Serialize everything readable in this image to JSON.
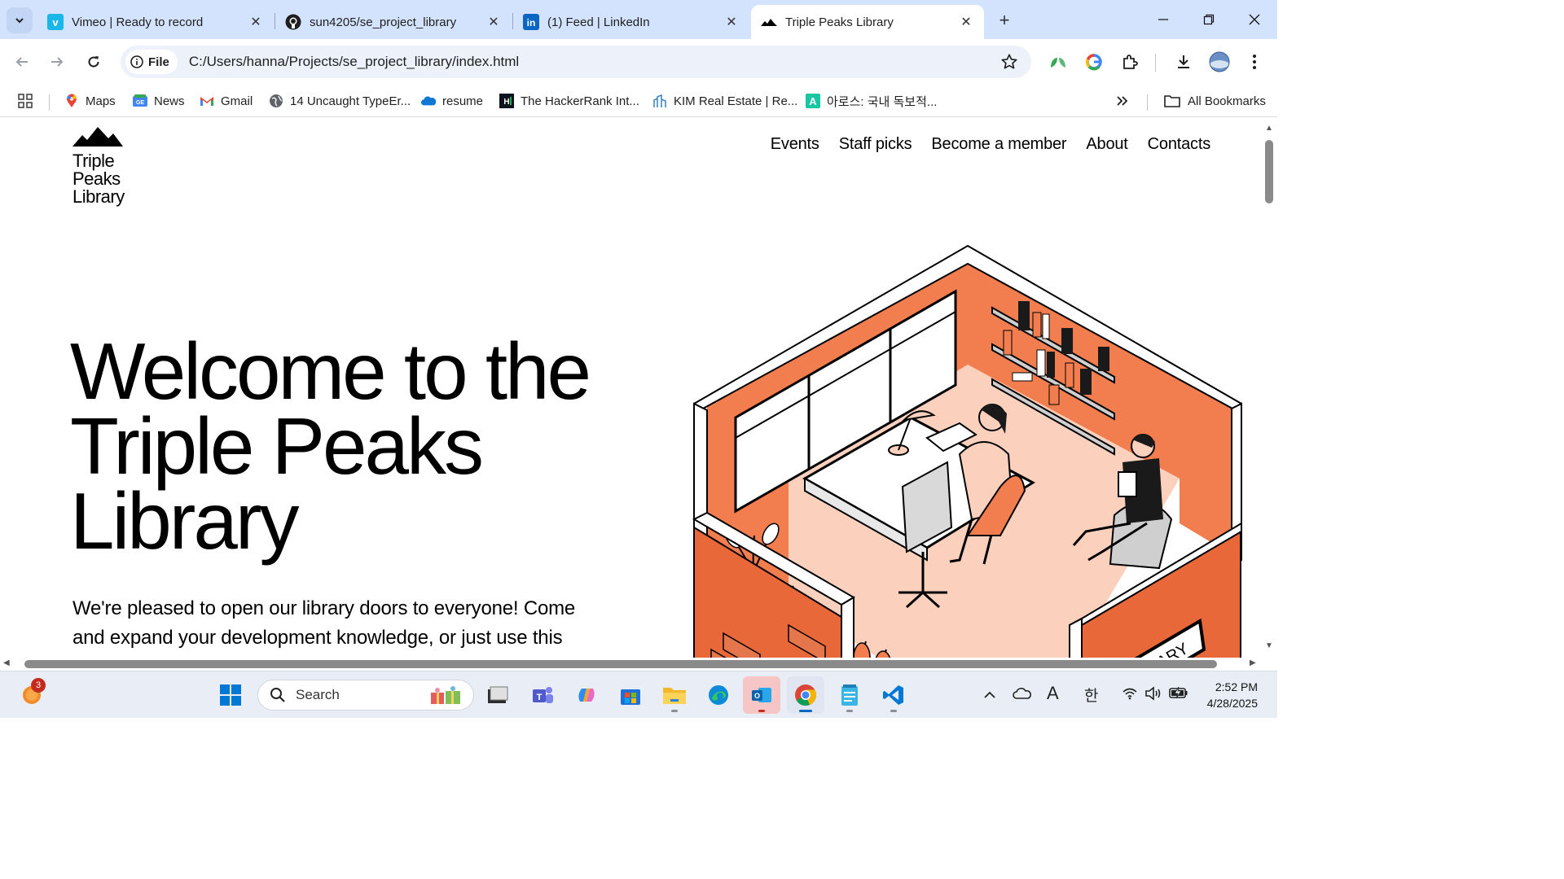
{
  "browser": {
    "tabs": [
      {
        "title": "Vimeo | Ready to record",
        "icon": "vimeo-icon",
        "active": false
      },
      {
        "title": "sun4205/se_project_library",
        "icon": "github-icon",
        "active": false
      },
      {
        "title": "(1) Feed | LinkedIn",
        "icon": "linkedin-icon",
        "active": false
      },
      {
        "title": "Triple Peaks Library",
        "icon": "mountain-icon",
        "active": true
      }
    ],
    "address": {
      "chip_label": "File",
      "url": "C:/Users/hanna/Projects/se_project_library/index.html"
    },
    "bookmarks": [
      {
        "label": "Maps",
        "icon": "maps-icon"
      },
      {
        "label": "News",
        "icon": "news-icon"
      },
      {
        "label": "Gmail",
        "icon": "gmail-icon"
      },
      {
        "label": "14 Uncaught TypeEr...",
        "icon": "globe-icon"
      },
      {
        "label": "resume",
        "icon": "onedrive-icon"
      },
      {
        "label": "The HackerRank Int...",
        "icon": "hackerrank-icon"
      },
      {
        "label": "KIM Real Estate | Re...",
        "icon": "building-icon"
      },
      {
        "label": "아로스: 국내 독보적...",
        "icon": "arose-icon"
      }
    ],
    "all_bookmarks_label": "All Bookmarks"
  },
  "site": {
    "logo_lines": [
      "Triple",
      "Peaks",
      "Library"
    ],
    "nav": [
      "Events",
      "Staff picks",
      "Become a member",
      "About",
      "Contacts"
    ],
    "hero_title_lines": [
      "Welcome to the",
      "Triple Peaks",
      "Library"
    ],
    "hero_text": "We're pleased to open our library doors to everyone! Come and expand your development knowledge, or just use this",
    "illustration_sign": "LIBRARY",
    "colors": {
      "accent": "#f27d4f",
      "floor": "#fbd0bd",
      "dark_orange": "#e9683a"
    }
  },
  "taskbar": {
    "search_placeholder": "Search",
    "notification_count": "3",
    "time": "2:52 PM",
    "date": "4/28/2025",
    "ime_label": "한",
    "font_label": "A"
  }
}
